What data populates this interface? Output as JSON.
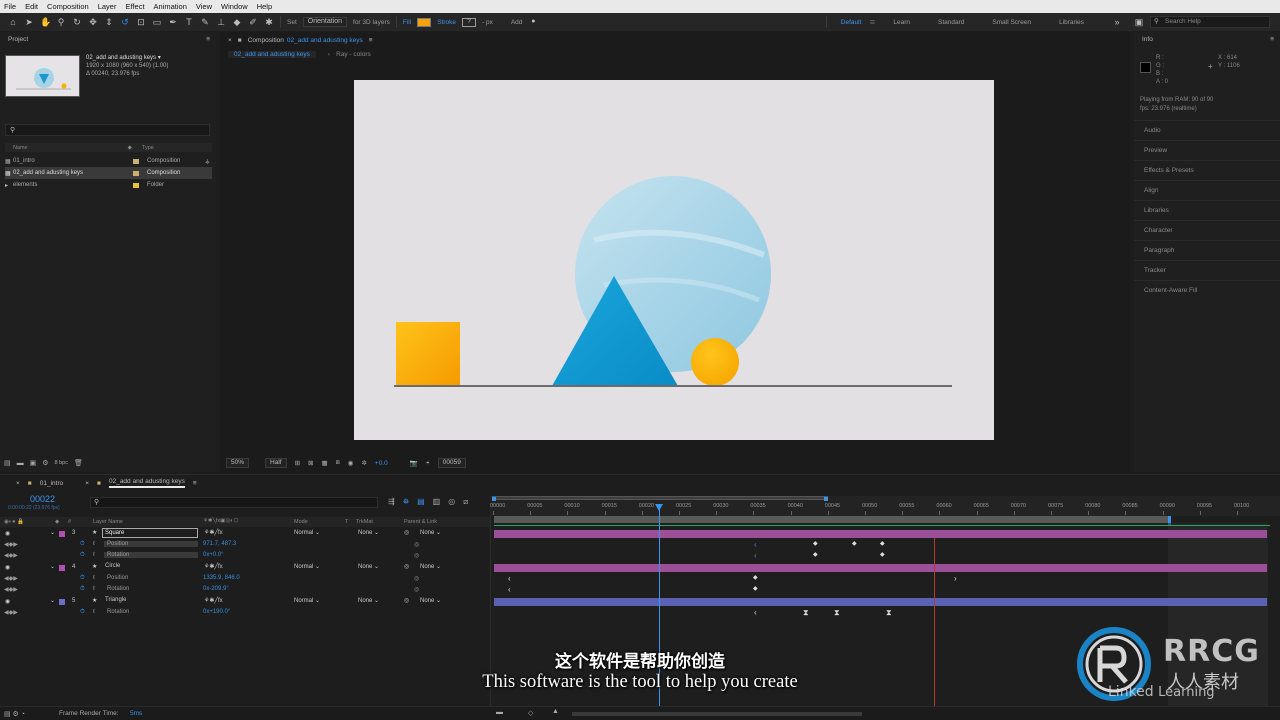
{
  "menu": [
    "File",
    "Edit",
    "Composition",
    "Layer",
    "Effect",
    "Animation",
    "View",
    "Window",
    "Help"
  ],
  "toolbar": {
    "set_label": "Set",
    "orientation": "Orientation",
    "for_3d": "for 3D layers",
    "fill_label": "Fill",
    "stroke_label": "Stroke",
    "stroke_value": "?",
    "px_label": "- px",
    "add_label": "Add",
    "fill_color": "#f2a20c",
    "workspaces": [
      "Default",
      "Learn",
      "Standard",
      "Small Screen",
      "Libraries"
    ],
    "active_workspace": "Default",
    "search_placeholder": "Search Help"
  },
  "project": {
    "panel_title": "Project",
    "comp_name": "02_add and adusting keys ▾",
    "comp_size": "1920 x 1080  (960 x 540) (1.00)",
    "comp_duration": "Δ 00240, 23.976 fps",
    "col_name": "Name",
    "col_type": "Type",
    "items": [
      {
        "name": "01_intro",
        "type": "Composition",
        "color": "#c8b070"
      },
      {
        "name": "02_add and adusting keys",
        "type": "Composition",
        "color": "#c8b070"
      },
      {
        "name": "elements",
        "type": "Folder",
        "color": "#e8c040"
      }
    ],
    "bpc": "8 bpc"
  },
  "viewer": {
    "tab_prefix": "Composition",
    "tab_comp": "02_add and adusting keys",
    "sub_tab": "02_add and adusting keys",
    "sub_tab2": "Ray - colors",
    "zoom": "50%",
    "resolution": "Half",
    "exposure": "+0.0",
    "frame": "00059"
  },
  "info": {
    "title": "Info",
    "r": "R :",
    "g": "G :",
    "b": "B :",
    "a": "A : 0",
    "x": "X : 614",
    "y": "Y : 1106",
    "ram_line1": "Playing from RAM: 90 of 90",
    "ram_line2": "fps: 23.976 (realtime)",
    "panels": [
      "Audio",
      "Preview",
      "Effects & Presets",
      "Align",
      "Libraries",
      "Character",
      "Paragraph",
      "Tracker",
      "Content-Aware Fill"
    ]
  },
  "timeline": {
    "tabs": [
      "01_intro",
      "02_add and adusting keys"
    ],
    "timecode": "00022",
    "timecode_sub": "0:00:00:22 (23.976 fps)",
    "col_layer": "Layer Name",
    "col_mode": "Mode",
    "col_t": "T",
    "col_trkmat": "TrkMat",
    "col_parent": "Parent & Link",
    "ruler_labels": [
      "00000",
      "00005",
      "00010",
      "00015",
      "00020",
      "00025",
      "00030",
      "00035",
      "00040",
      "00045",
      "00050",
      "00055",
      "00060",
      "00065",
      "00070",
      "00075",
      "00080",
      "00085",
      "00090",
      "00095",
      "00100"
    ],
    "layers": [
      {
        "num": "3",
        "name": "Square",
        "mode": "Normal",
        "trkmat": "None",
        "parent": "None",
        "color": "#b04fae",
        "props": [
          {
            "name": "Position",
            "value": "971.7, 487.3"
          },
          {
            "name": "Rotation",
            "value": "0x+0.0°"
          }
        ]
      },
      {
        "num": "4",
        "name": "Circle",
        "mode": "Normal",
        "trkmat": "None",
        "parent": "None",
        "color": "#b04fae",
        "props": [
          {
            "name": "Position",
            "value": "1335.9, 846.0"
          },
          {
            "name": "Rotation",
            "value": "0x-209.9°"
          }
        ]
      },
      {
        "num": "5",
        "name": "Triangle",
        "mode": "Normal",
        "trkmat": "None",
        "parent": "None",
        "color": "#6a70c8",
        "props": [
          {
            "name": "Rotation",
            "value": "0x+190.0°"
          }
        ]
      }
    ],
    "frame_render_label": "Frame Render Time:",
    "frame_render_value": "5ms"
  },
  "subtitle": {
    "cn": "这个软件是帮助你创造",
    "en": "This software is the tool to help you create"
  },
  "watermark": {
    "brand": "RRCG",
    "cn": "人人素材",
    "linked": "Linked",
    "learning": "Learning"
  }
}
